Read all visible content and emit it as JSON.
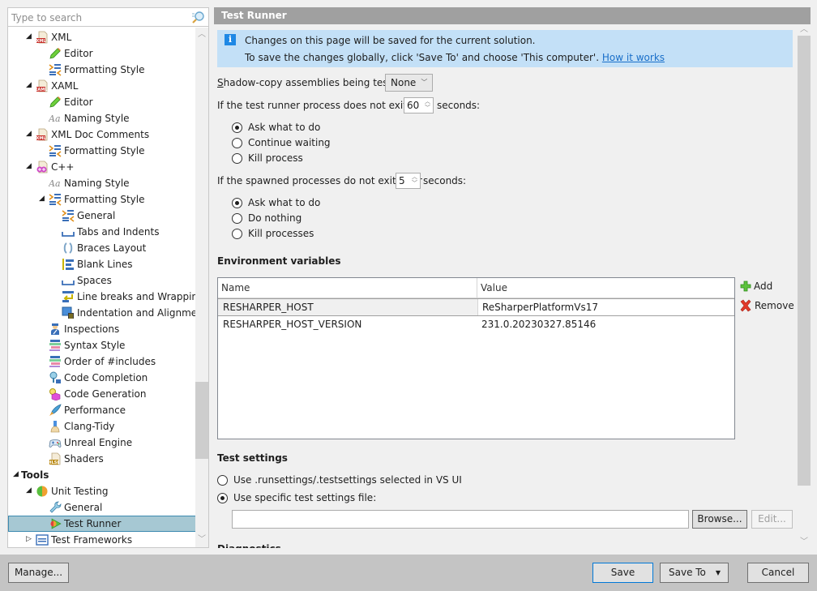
{
  "search": {
    "placeholder": "Type to search",
    "value": ""
  },
  "tree": [
    {
      "label": "XML",
      "depth": 1,
      "toggle": "expanded",
      "icon": "xml-file-icon"
    },
    {
      "label": "Editor",
      "depth": 2,
      "toggle": "none",
      "icon": "pencil-icon"
    },
    {
      "label": "Formatting Style",
      "depth": 2,
      "toggle": "none",
      "icon": "formatting-style-icon"
    },
    {
      "label": "XAML",
      "depth": 1,
      "toggle": "expanded",
      "icon": "xaml-file-icon"
    },
    {
      "label": "Editor",
      "depth": 2,
      "toggle": "none",
      "icon": "pencil-icon"
    },
    {
      "label": "Naming Style",
      "depth": 2,
      "toggle": "none",
      "icon": "naming-style-icon"
    },
    {
      "label": "XML Doc Comments",
      "depth": 1,
      "toggle": "expanded",
      "icon": "xml-file-icon"
    },
    {
      "label": "Formatting Style",
      "depth": 2,
      "toggle": "none",
      "icon": "formatting-style-icon"
    },
    {
      "label": "C++",
      "depth": 1,
      "toggle": "expanded",
      "icon": "cpp-file-icon"
    },
    {
      "label": "Naming Style",
      "depth": 2,
      "toggle": "none",
      "icon": "naming-style-icon"
    },
    {
      "label": "Formatting Style",
      "depth": 2,
      "toggle": "expanded",
      "icon": "formatting-style-icon"
    },
    {
      "label": "General",
      "depth": 3,
      "toggle": "none",
      "icon": "formatting-style-icon"
    },
    {
      "label": "Tabs and Indents",
      "depth": 3,
      "toggle": "none",
      "icon": "tabs-icon"
    },
    {
      "label": "Braces Layout",
      "depth": 3,
      "toggle": "none",
      "icon": "braces-icon"
    },
    {
      "label": "Blank Lines",
      "depth": 3,
      "toggle": "none",
      "icon": "blank-lines-icon"
    },
    {
      "label": "Spaces",
      "depth": 3,
      "toggle": "none",
      "icon": "spaces-icon"
    },
    {
      "label": "Line breaks and Wrapping",
      "depth": 3,
      "toggle": "none",
      "icon": "line-wrap-icon"
    },
    {
      "label": "Indentation and Alignment",
      "depth": 3,
      "toggle": "none",
      "icon": "indentation-icon"
    },
    {
      "label": "Inspections",
      "depth": 2,
      "toggle": "none",
      "icon": "inspector-icon"
    },
    {
      "label": "Syntax Style",
      "depth": 2,
      "toggle": "none",
      "icon": "syntax-style-icon"
    },
    {
      "label": "Order of #includes",
      "depth": 2,
      "toggle": "none",
      "icon": "syntax-style-icon"
    },
    {
      "label": "Code Completion",
      "depth": 2,
      "toggle": "none",
      "icon": "code-completion-icon"
    },
    {
      "label": "Code Generation",
      "depth": 2,
      "toggle": "none",
      "icon": "code-generation-icon"
    },
    {
      "label": "Performance",
      "depth": 2,
      "toggle": "none",
      "icon": "rocket-icon"
    },
    {
      "label": "Clang-Tidy",
      "depth": 2,
      "toggle": "none",
      "icon": "brush-icon"
    },
    {
      "label": "Unreal Engine",
      "depth": 2,
      "toggle": "none",
      "icon": "gamepad-icon"
    },
    {
      "label": "Shaders",
      "depth": 2,
      "toggle": "none",
      "icon": "hlsl-file-icon"
    },
    {
      "label": "Tools",
      "depth": 0,
      "toggle": "expanded",
      "icon": "",
      "bold": true
    },
    {
      "label": "Unit Testing",
      "depth": 1,
      "toggle": "expanded",
      "icon": "unit-testing-icon"
    },
    {
      "label": "General",
      "depth": 2,
      "toggle": "none",
      "icon": "wrench-icon"
    },
    {
      "label": "Test Runner",
      "depth": 2,
      "toggle": "none",
      "icon": "test-runner-icon",
      "selected": true
    },
    {
      "label": "Test Frameworks",
      "depth": 1,
      "toggle": "collapsed",
      "icon": "test-frameworks-icon"
    }
  ],
  "header": {
    "title": "Test Runner"
  },
  "info": {
    "line1": "Changes on this page will be saved for the current solution.",
    "line2": "To save the changes globally, click 'Save To' and choose 'This computer'.",
    "link": "How it works"
  },
  "shadow_copy": {
    "label": "Shadow-copy assemblies being tested",
    "value": "None"
  },
  "runner_timeout": {
    "prefix": "If the test runner process does not exit after",
    "value": "60",
    "suffix": "seconds:",
    "options": [
      {
        "label": "Ask what to do",
        "checked": true
      },
      {
        "label": "Continue waiting",
        "checked": false
      },
      {
        "label": "Kill process",
        "checked": false
      }
    ]
  },
  "spawned_timeout": {
    "prefix": "If the spawned processes do not exit after",
    "value": "5",
    "suffix": "seconds:",
    "options": [
      {
        "label": "Ask what to do",
        "checked": true
      },
      {
        "label": "Do nothing",
        "checked": false
      },
      {
        "label": "Kill processes",
        "checked": false
      }
    ]
  },
  "env": {
    "title": "Environment variables",
    "columns": [
      "Name",
      "Value"
    ],
    "rows": [
      {
        "name": "RESHARPER_HOST",
        "value": "ReSharperPlatformVs17",
        "selected": true
      },
      {
        "name": "RESHARPER_HOST_VERSION",
        "value": "231.0.20230327.85146",
        "selected": false
      }
    ],
    "add_label": "Add",
    "remove_label": "Remove"
  },
  "test_settings": {
    "title": "Test settings",
    "options": [
      {
        "label": "Use .runsettings/.testsettings selected in VS UI",
        "checked": false
      },
      {
        "label": "Use specific test settings file:",
        "checked": true
      }
    ],
    "file_value": "",
    "browse_label": "Browse...",
    "edit_label": "Edit..."
  },
  "next_section": "Diagnostics",
  "footer": {
    "manage_label": "Manage...",
    "save_label": "Save",
    "save_to_label": "Save To",
    "cancel_label": "Cancel"
  }
}
